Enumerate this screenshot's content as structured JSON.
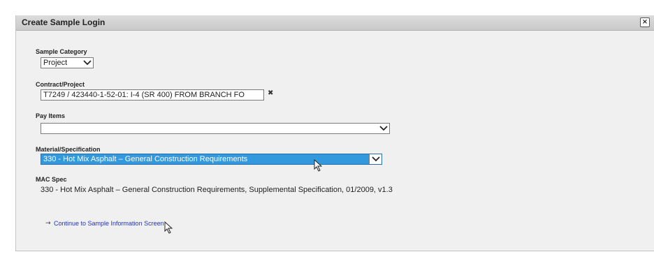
{
  "dialog": {
    "title": "Create Sample Login",
    "close_icon": "close-icon"
  },
  "sample_category": {
    "label": "Sample Category",
    "selected": "Project"
  },
  "contract_project": {
    "label": "Contract/Project",
    "value": "T7249 / 423440-1-52-01: I-4 (SR 400) FROM BRANCH FO",
    "clear_icon": "close-icon",
    "clear_glyph": "✖"
  },
  "pay_items": {
    "label": "Pay Items",
    "selected": ""
  },
  "material_specification": {
    "label": "Material/Specification",
    "selected": "330 - Hot Mix Asphalt – General Construction Requirements"
  },
  "mac_spec": {
    "label": "MAC Spec",
    "value": "330 - Hot Mix Asphalt – General Construction Requirements, Supplemental Specification, 01/2009, v1.3"
  },
  "continue_link": {
    "arrow_glyph": "→",
    "label": "Continue to Sample Information Screen"
  },
  "colors": {
    "accent": "#3399dd",
    "link": "#2233bb",
    "dialog_bg": "#f0f0f0"
  }
}
